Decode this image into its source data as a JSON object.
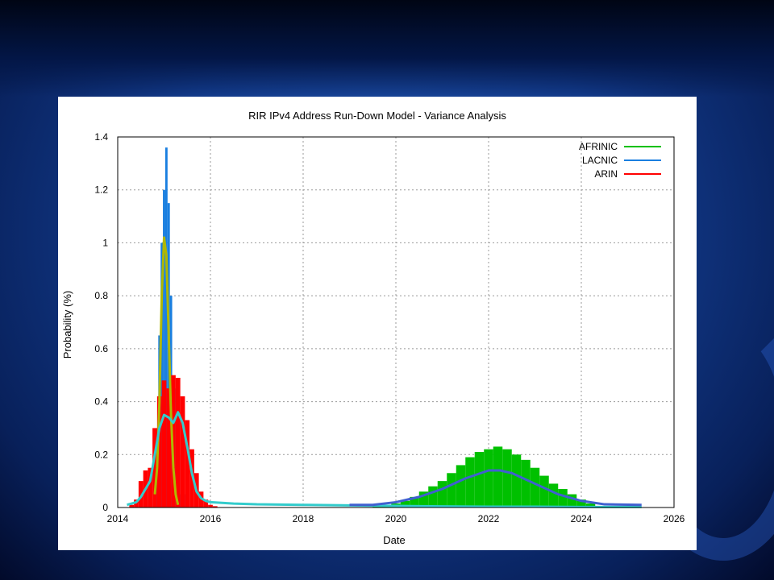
{
  "chart_data": {
    "type": "bar",
    "title": "RIR IPv4 Address Run-Down Model - Variance Analysis",
    "xlabel": "Date",
    "ylabel": "Probability (%)",
    "xlim": [
      2014,
      2026
    ],
    "ylim": [
      0,
      1.4
    ],
    "xticks": [
      "2014",
      "2016",
      "2018",
      "2020",
      "2022",
      "2024",
      "2026"
    ],
    "yticks": [
      "0",
      "0.2",
      "0.4",
      "0.6",
      "0.8",
      "1",
      "1.2",
      "1.4"
    ],
    "grid": true,
    "legend_position": "top-right",
    "series": [
      {
        "name": "AFRINIC",
        "color": "#00c000",
        "style": "bars",
        "x": [
          2019.6,
          2019.8,
          2020.0,
          2020.2,
          2020.4,
          2020.6,
          2020.8,
          2021.0,
          2021.2,
          2021.4,
          2021.6,
          2021.8,
          2022.0,
          2022.2,
          2022.4,
          2022.6,
          2022.8,
          2023.0,
          2023.2,
          2023.4,
          2023.6,
          2023.8,
          2024.0,
          2024.2,
          2024.4
        ],
        "values": [
          0.003,
          0.008,
          0.015,
          0.025,
          0.04,
          0.06,
          0.08,
          0.1,
          0.13,
          0.16,
          0.19,
          0.21,
          0.22,
          0.23,
          0.22,
          0.2,
          0.18,
          0.15,
          0.12,
          0.09,
          0.07,
          0.05,
          0.03,
          0.015,
          0.005
        ]
      },
      {
        "name": "LACNIC",
        "color": "#1a7fe0",
        "style": "bars",
        "x": [
          2014.7,
          2014.8,
          2014.85,
          2014.9,
          2014.95,
          2015.0,
          2015.05,
          2015.1,
          2015.15,
          2015.2,
          2015.3,
          2015.4
        ],
        "values": [
          0.03,
          0.1,
          0.3,
          0.65,
          1.0,
          1.2,
          1.36,
          1.15,
          0.8,
          0.45,
          0.2,
          0.05
        ]
      },
      {
        "name": "ARIN",
        "color": "#ff0000",
        "style": "bars",
        "x": [
          2014.3,
          2014.4,
          2014.5,
          2014.6,
          2014.7,
          2014.8,
          2014.9,
          2015.0,
          2015.1,
          2015.2,
          2015.3,
          2015.4,
          2015.5,
          2015.6,
          2015.7,
          2015.8,
          2015.9,
          2016.0,
          2016.1
        ],
        "values": [
          0.01,
          0.03,
          0.1,
          0.14,
          0.15,
          0.3,
          0.42,
          0.48,
          0.45,
          0.5,
          0.49,
          0.42,
          0.33,
          0.22,
          0.13,
          0.06,
          0.03,
          0.01,
          0.005
        ]
      },
      {
        "color": "#b0b800",
        "style": "line",
        "x": [
          2014.8,
          2014.85,
          2014.9,
          2014.95,
          2015.0,
          2015.05,
          2015.1,
          2015.15,
          2015.2,
          2015.25,
          2015.3
        ],
        "values": [
          0.05,
          0.15,
          0.4,
          0.8,
          1.02,
          0.95,
          0.65,
          0.35,
          0.15,
          0.05,
          0.01
        ]
      },
      {
        "color": "#33cccc",
        "style": "line",
        "x": [
          2014.2,
          2014.4,
          2014.5,
          2014.6,
          2014.7,
          2014.8,
          2014.9,
          2015.0,
          2015.1,
          2015.2,
          2015.3,
          2015.4,
          2015.5,
          2015.6,
          2015.7,
          2015.8,
          2015.9,
          2016.0,
          2016.5,
          2017.0,
          2018.0,
          2019.0,
          2020.0,
          2021.0,
          2022.0,
          2023.0,
          2024.0,
          2025.3
        ],
        "values": [
          0.01,
          0.02,
          0.04,
          0.07,
          0.1,
          0.2,
          0.3,
          0.35,
          0.34,
          0.32,
          0.36,
          0.32,
          0.23,
          0.13,
          0.06,
          0.035,
          0.025,
          0.02,
          0.015,
          0.012,
          0.01,
          0.008,
          0.006,
          0.004,
          0.003,
          0.003,
          0.002,
          0.002
        ]
      },
      {
        "color": "#4060d0",
        "style": "line",
        "x": [
          2019.0,
          2019.5,
          2020.0,
          2020.5,
          2021.0,
          2021.5,
          2022.0,
          2022.25,
          2022.5,
          2023.0,
          2023.5,
          2024.0,
          2024.5,
          2025.3
        ],
        "values": [
          0.01,
          0.01,
          0.02,
          0.04,
          0.07,
          0.11,
          0.14,
          0.14,
          0.13,
          0.09,
          0.05,
          0.025,
          0.012,
          0.01
        ]
      }
    ]
  }
}
